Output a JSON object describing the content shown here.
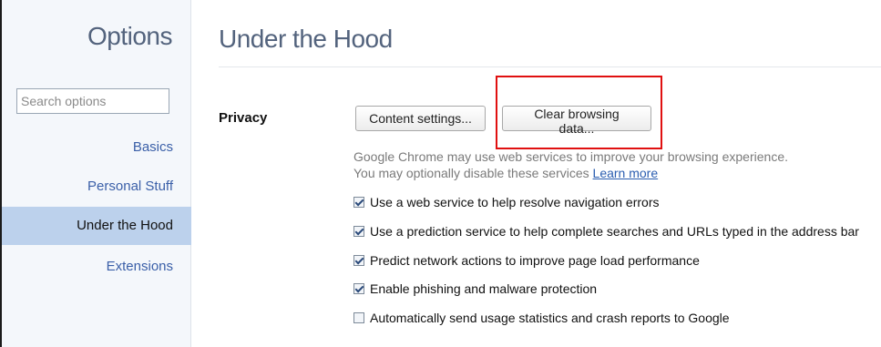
{
  "sidebar": {
    "title": "Options",
    "search_placeholder": "Search options",
    "items": [
      {
        "label": "Basics"
      },
      {
        "label": "Personal Stuff"
      },
      {
        "label": "Under the Hood",
        "selected": true
      },
      {
        "label": "Extensions"
      }
    ]
  },
  "main": {
    "title": "Under the Hood",
    "section_label": "Privacy",
    "buttons": {
      "content_settings": "Content settings...",
      "clear_browsing_data": "Clear browsing data..."
    },
    "description_line1": "Google Chrome may use web services to improve your browsing experience.",
    "description_line2": "You may optionally disable these services",
    "learn_more": "Learn more",
    "checkboxes": [
      {
        "label": "Use a web service to help resolve navigation errors",
        "checked": true
      },
      {
        "label": "Use a prediction service to help complete searches and URLs typed in the address bar",
        "checked": true
      },
      {
        "label": "Predict network actions to improve page load performance",
        "checked": true
      },
      {
        "label": "Enable phishing and malware protection",
        "checked": true
      },
      {
        "label": "Automatically send usage statistics and crash reports to Google",
        "checked": false
      }
    ]
  },
  "colors": {
    "accent": "#3a5fa8",
    "selected_nav": "#bcd1ec",
    "highlight_box": "#e01010"
  }
}
